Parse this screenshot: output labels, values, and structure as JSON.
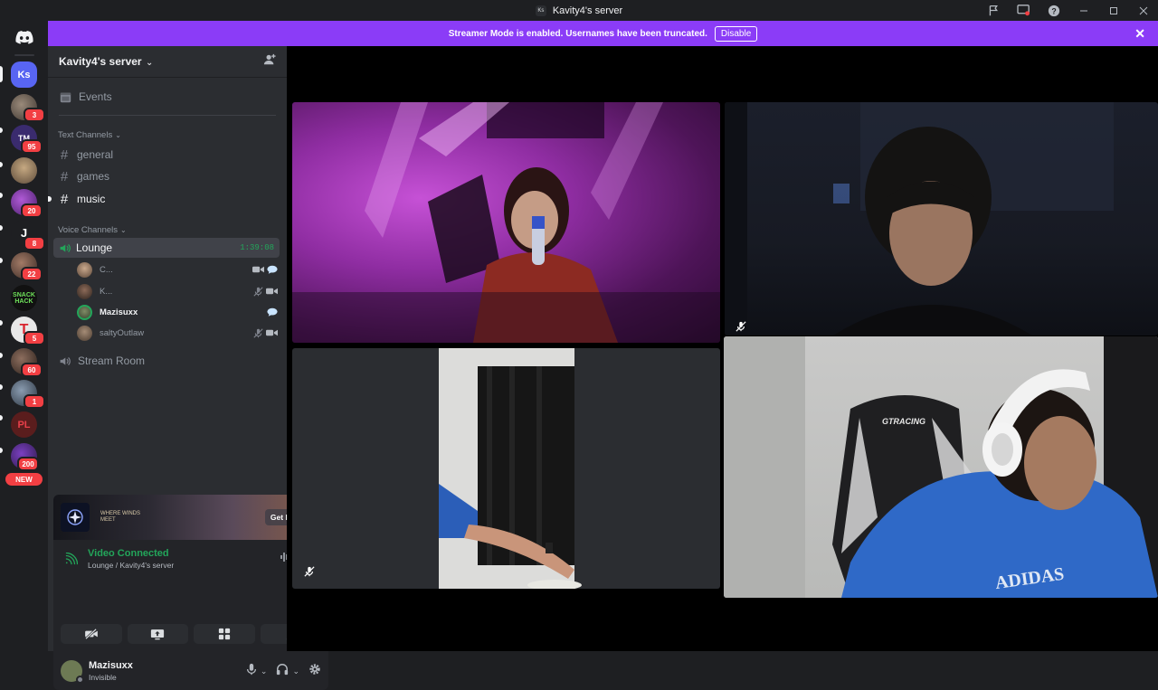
{
  "window": {
    "title": "Kavity4's server",
    "logo_text": "Ks"
  },
  "banner": {
    "message": "Streamer Mode is enabled. Usernames have been truncated.",
    "button": "Disable"
  },
  "rail": {
    "servers": [
      {
        "label": "Ks",
        "color": "#5865f2"
      },
      {
        "badge": "3"
      },
      {
        "badge": "95",
        "label": "TM"
      },
      {},
      {
        "badge": "20"
      },
      {
        "label": "J",
        "badge": "8"
      },
      {
        "badge": "22"
      },
      {
        "label": "SNACK HACK"
      },
      {
        "label": "T",
        "badge": "5"
      },
      {
        "badge": "60"
      },
      {
        "badge": "1"
      },
      {
        "label": "PL"
      },
      {
        "badge": "200"
      }
    ],
    "new_badge": "NEW"
  },
  "sidebar": {
    "server_name": "Kavity4's server",
    "events_label": "Events",
    "text_category": "Text Channels",
    "text_channels": [
      "general",
      "games",
      "music"
    ],
    "voice_category": "Voice Channels",
    "voice_channel": "Lounge",
    "voice_timer": "1:39:08",
    "members": [
      "C...",
      "K...",
      "Mazisuxx",
      "saltyOutlaw"
    ],
    "stream_room": "Stream Room"
  },
  "promo": {
    "game_name": "WHERE WINDS MEET",
    "reward_button": "Get Reward!"
  },
  "voice_status": {
    "status": "Video Connected",
    "location": "Lounge / Kavity4's server"
  },
  "user": {
    "name": "Mazisuxx",
    "status": "Invisible"
  },
  "colors": {
    "banner": "#8b3cf7",
    "connected": "#23a55a",
    "badge": "#f23f43"
  }
}
